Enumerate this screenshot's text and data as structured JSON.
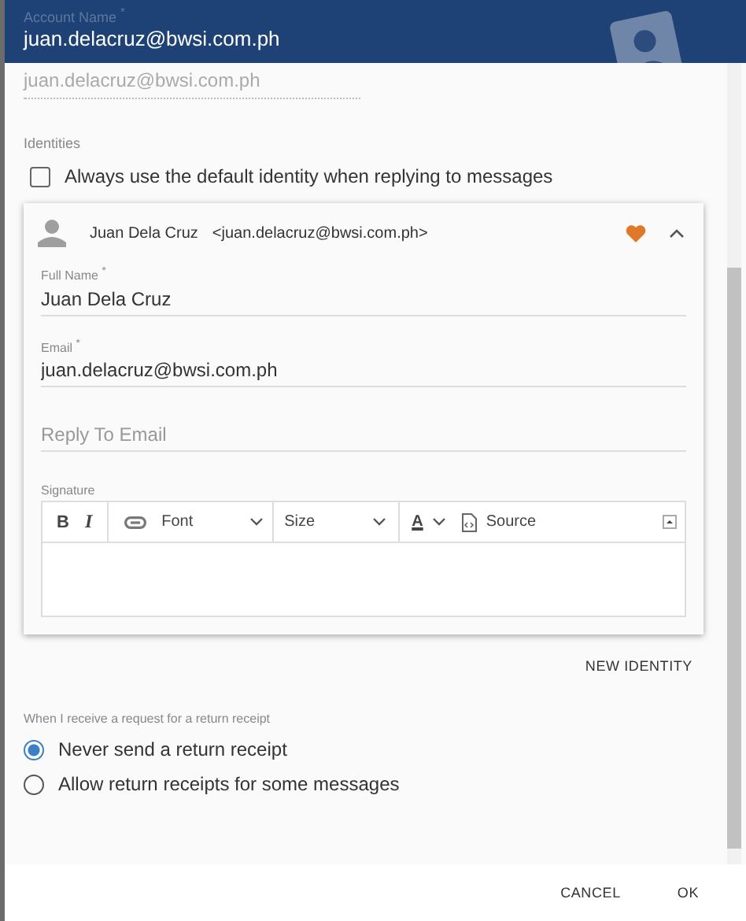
{
  "header": {
    "label": "Account Name $^{*}$",
    "value": "juan.delacruz@bwsi.com.ph"
  },
  "account_field": {
    "value": "juan.delacruz@bwsi.com.ph",
    "disabled": true
  },
  "identities": {
    "label": "Identities",
    "default_checkbox": {
      "label": "Always use the default identity when replying to messages",
      "checked": false
    },
    "identity": {
      "name": "Juan Dela Cruz",
      "address": "<juan.delacruz@bwsi.com.ph>",
      "favorite": true,
      "expanded": true,
      "fields": [
        {
          "label": "Full Name $^{*}$",
          "value": "Juan Dela Cruz"
        },
        {
          "label": "Email $^{*}$",
          "value": "juan.delacruz@bwsi.com.ph"
        },
        {
          "placeholder": "Reply To Email"
        }
      ],
      "signature": {
        "label": "Signature",
        "toolbar": [
          [
            {
              "kind": "bold",
              "text": "B"
            },
            {
              "kind": "italic",
              "text": "I"
            }
          ],
          [
            {
              "kind": "link"
            },
            {
              "kind": "dropdown",
              "text": "Font"
            }
          ],
          [
            {
              "kind": "dropdown",
              "text": "Size"
            }
          ],
          [
            {
              "kind": "color",
              "text": "A"
            },
            {
              "kind": "source",
              "text": "Source"
            }
          ]
        ]
      }
    },
    "new_button": "NEW IDENTITY"
  },
  "receipts": {
    "label": "When I receive a request for a return receipt",
    "options": [
      {
        "label": "Never send a return receipt",
        "selected": true
      },
      {
        "label": "Allow return receipts for some messages",
        "selected": false
      }
    ]
  },
  "buttons": [
    "CANCEL",
    "OK"
  ]
}
